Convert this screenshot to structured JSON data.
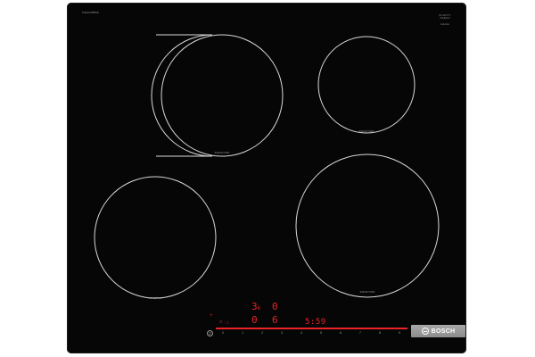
{
  "panel": {
    "model_label": "PUE631BB5E",
    "glass_brand": "SCHOTT CERAN",
    "glass_sub": "Induction"
  },
  "zones": [
    {
      "label": "INDUCTION"
    },
    {
      "label": "INDUCTION"
    },
    {
      "label": "INDUCTION"
    },
    {
      "label": "INDUCTION"
    }
  ],
  "display": {
    "rear_left": "3",
    "rear_left_suffix": "k",
    "rear_right": "0",
    "front_left": "0",
    "front_right": "6",
    "timer": "5:59",
    "plus_symbol": "+",
    "minor": "⊡ :: △"
  },
  "power_symbol": "⏻",
  "scale": [
    "0",
    "1",
    "2",
    "3",
    "4",
    "5",
    "6",
    "7",
    "8",
    "9"
  ],
  "brand": {
    "name": "BOSCH"
  },
  "colors": {
    "cooktop": "#060606",
    "zone_outline": "#d9d9d9",
    "display_red": "#e8242a",
    "brand_plate": "#9a9a9a"
  },
  "icons": {
    "power": "power-icon",
    "brand_logo": "bosch-logo-icon"
  }
}
